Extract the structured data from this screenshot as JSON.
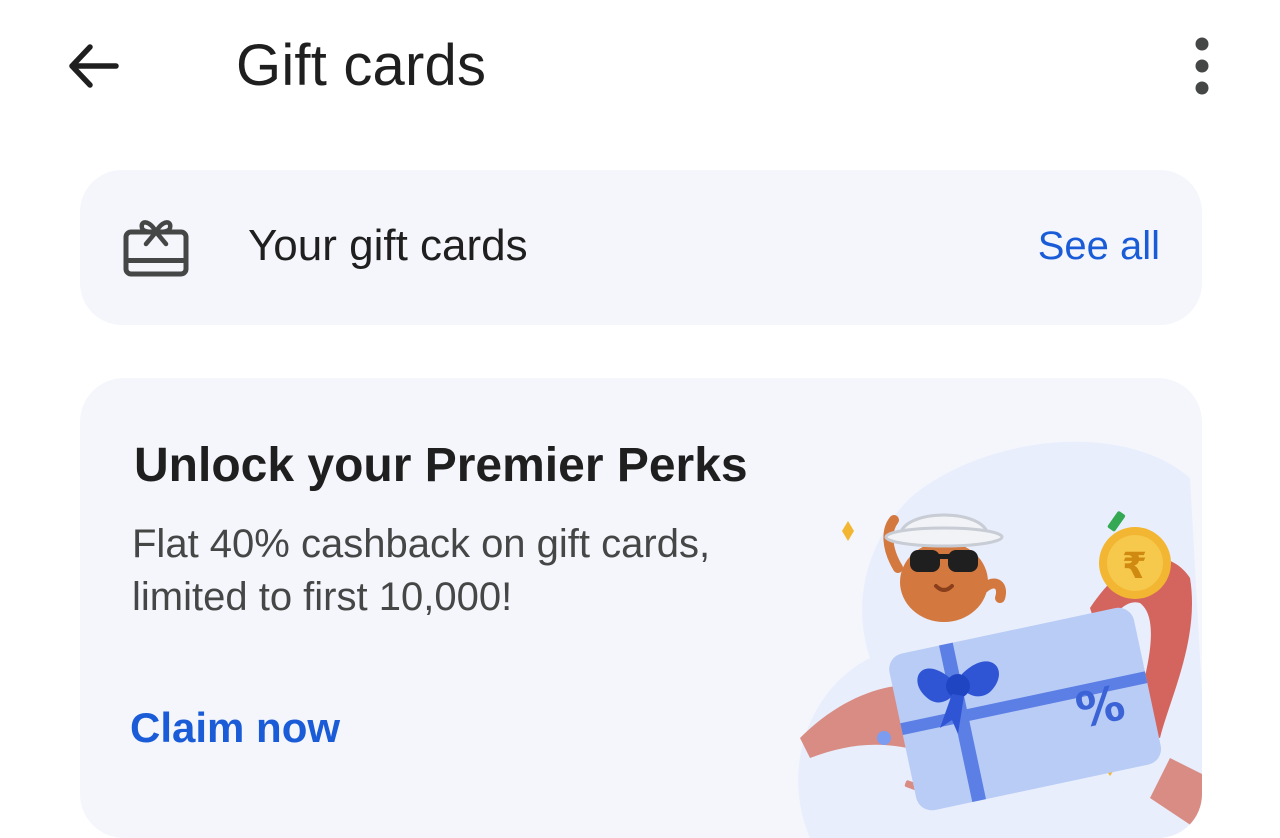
{
  "app_bar": {
    "title": "Gift cards",
    "back_icon": "arrow-back-icon",
    "more_icon": "more-vert-icon"
  },
  "your_gift_cards": {
    "icon": "gift-card-icon",
    "label": "Your gift cards",
    "action": "See all"
  },
  "promo": {
    "title": "Unlock your Premier Perks",
    "description_line1": "Flat 40% cashback on gift cards,",
    "description_line2": "limited to first 10,000!",
    "cta": "Claim now",
    "illustration": "gift-card-mascot-illustration",
    "coin_symbol": "₹",
    "card_symbol": "%"
  },
  "colors": {
    "accent": "#1a5cd7",
    "card_background": "#f4f6fb",
    "text_primary": "#1f1f1f",
    "text_secondary": "#444746"
  }
}
